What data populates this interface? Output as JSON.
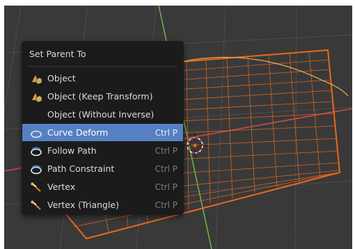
{
  "menu": {
    "title": "Set Parent To",
    "items": [
      {
        "label": "Object",
        "shortcut": "",
        "icon": "object-data-icon",
        "active": false
      },
      {
        "label": "Object (Keep Transform)",
        "shortcut": "",
        "icon": "object-data-icon",
        "active": false
      },
      {
        "label": "Object (Without Inverse)",
        "shortcut": "",
        "icon": "",
        "active": false
      },
      {
        "label": "Curve Deform",
        "shortcut": "Ctrl P",
        "icon": "curve-modifier-icon",
        "active": true
      },
      {
        "label": "Follow Path",
        "shortcut": "Ctrl P",
        "icon": "curve-modifier-icon",
        "active": false
      },
      {
        "label": "Path Constraint",
        "shortcut": "Ctrl P",
        "icon": "curve-modifier-icon",
        "active": false
      },
      {
        "label": "Vertex",
        "shortcut": "Ctrl P",
        "icon": "vertex-icon",
        "active": false
      },
      {
        "label": "Vertex (Triangle)",
        "shortcut": "Ctrl P",
        "icon": "vertex-icon",
        "active": false
      }
    ]
  },
  "colors": {
    "viewport_bg": "#393939",
    "menu_bg": "#1b1b1b",
    "highlight": "#5680c2",
    "mesh_orange": "#e8681c",
    "curve_yellow": "#e2a94a",
    "axis_red": "#c84a4a",
    "axis_green": "#6ab04c"
  }
}
